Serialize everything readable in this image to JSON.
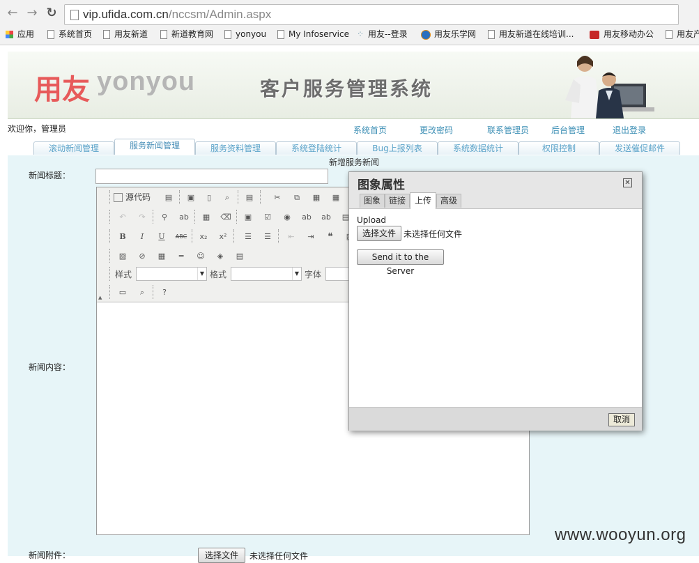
{
  "browser": {
    "url_host": "vip.ufida.com.cn",
    "url_path": "/nccsm/Admin.aspx",
    "bookmarks": [
      "应用",
      "系统首页",
      "用友新道",
      "新道教育网",
      "yonyou",
      "My Infoservice",
      "用友--登录",
      "用友乐学网",
      "用友新道在线培训...",
      "用友移动办公",
      "用友产"
    ]
  },
  "banner": {
    "logo_cn": "用友",
    "logo_en": "yonyou",
    "system_title": "客户服务管理系统"
  },
  "header": {
    "welcome": "欢迎你，管理员",
    "links": [
      "系统首页",
      "更改密码",
      "联系管理员",
      "后台管理",
      "退出登录"
    ]
  },
  "tabs": [
    "滚动新闻管理",
    "服务新闻管理",
    "服务资料管理",
    "系统登陆统计",
    "Bug上报列表",
    "系统数据统计",
    "权限控制",
    "发送催促邮件"
  ],
  "active_tab": "服务新闻管理",
  "form": {
    "heading": "新增服务新闻",
    "title_label": "新闻标题：",
    "content_label": "新闻内容：",
    "attachment_label": "新闻附件：",
    "attachment_button": "选择文件",
    "attachment_status": "未选择任何文件"
  },
  "editor": {
    "source_label": "源代码",
    "style_label": "样式",
    "format_label": "格式",
    "font_label": "字体"
  },
  "dialog": {
    "title": "图象属性",
    "tabs": [
      "图象",
      "链接",
      "上传",
      "高级"
    ],
    "active_tab": "上传",
    "upload_label": "Upload",
    "choose_file": "选择文件",
    "no_file": "未选择任何文件",
    "send_button": "Send it to the Server",
    "cancel": "取消"
  },
  "watermark": "www.wooyun.org"
}
